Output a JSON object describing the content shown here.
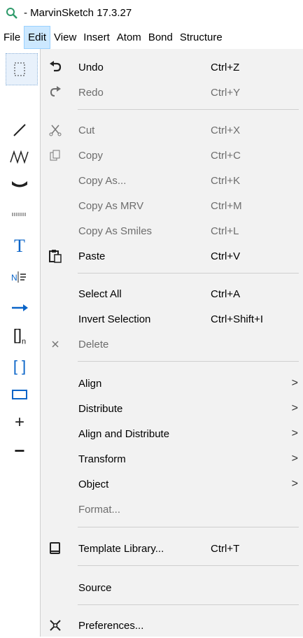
{
  "window": {
    "title": "- MarvinSketch 17.3.27"
  },
  "menubar": [
    "File",
    "Edit",
    "View",
    "Insert",
    "Atom",
    "Bond",
    "Structure"
  ],
  "menu": {
    "undo": {
      "label": "Undo",
      "shortcut": "Ctrl+Z"
    },
    "redo": {
      "label": "Redo",
      "shortcut": "Ctrl+Y"
    },
    "cut": {
      "label": "Cut",
      "shortcut": "Ctrl+X"
    },
    "copy": {
      "label": "Copy",
      "shortcut": "Ctrl+C"
    },
    "copy_as": {
      "label": "Copy As...",
      "shortcut": "Ctrl+K"
    },
    "copy_as_mrv": {
      "label": "Copy As MRV",
      "shortcut": "Ctrl+M"
    },
    "copy_as_smiles": {
      "label": "Copy As Smiles",
      "shortcut": "Ctrl+L"
    },
    "paste": {
      "label": "Paste",
      "shortcut": "Ctrl+V"
    },
    "select_all": {
      "label": "Select All",
      "shortcut": "Ctrl+A"
    },
    "invert_selection": {
      "label": "Invert Selection",
      "shortcut": "Ctrl+Shift+I"
    },
    "delete": {
      "label": "Delete"
    },
    "align": {
      "label": "Align"
    },
    "distribute": {
      "label": "Distribute"
    },
    "align_and_distribute": {
      "label": "Align and Distribute"
    },
    "transform": {
      "label": "Transform"
    },
    "object": {
      "label": "Object"
    },
    "format": {
      "label": "Format..."
    },
    "template_library": {
      "label": "Template Library...",
      "shortcut": "Ctrl+T"
    },
    "source": {
      "label": "Source"
    },
    "preferences": {
      "label": "Preferences..."
    },
    "submenu_arrow": ">"
  },
  "toolbar": {
    "text_tool": "T",
    "bracket_n": "[]",
    "bracket_n_sub": "n",
    "bracket": "[ ]",
    "plus": "+",
    "minus": "−"
  },
  "colors": {
    "menu_bg": "#f2f2f2",
    "menubar_active": "#cce8ff",
    "accent_blue": "#0a64c8"
  },
  "icons": [
    "marvin-app-icon",
    "selection-tool-icon",
    "undo-icon",
    "redo-icon",
    "cut-icon",
    "copy-icon",
    "paste-icon",
    "delete-icon",
    "template-library-icon",
    "preferences-icon"
  ]
}
